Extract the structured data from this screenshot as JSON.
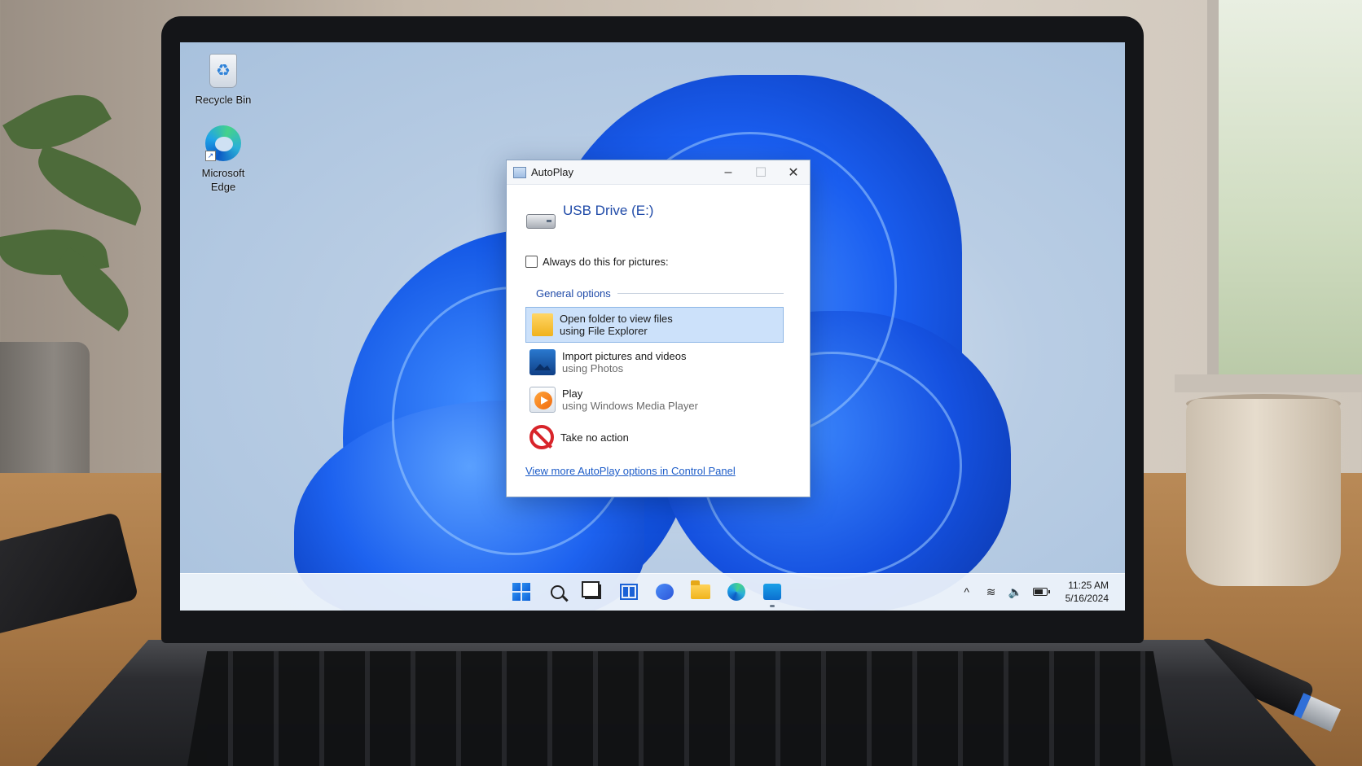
{
  "desktop": {
    "icons": [
      {
        "label": "Recycle Bin"
      },
      {
        "label": "Microsoft\nEdge",
        "label_line1": "Microsoft",
        "label_line2": "Edge"
      }
    ]
  },
  "dialog": {
    "title": "AutoPlay",
    "device_name": "USB Drive (E:)",
    "always_label": "Always do this for pictures:",
    "always_checked": false,
    "group_title": "General options",
    "options": [
      {
        "title": "Open folder to view files",
        "subtitle": "using File Explorer",
        "icon": "folder-icon",
        "selected": true
      },
      {
        "title": "Import pictures and videos",
        "subtitle": "using Photos",
        "icon": "photos-icon",
        "selected": false
      },
      {
        "title": "Play",
        "subtitle": "using Windows Media Player",
        "icon": "media-player-icon",
        "selected": false
      },
      {
        "title": "Take no action",
        "subtitle": "",
        "icon": "no-action-icon",
        "selected": false
      }
    ],
    "control_panel_link": "View more AutoPlay options in Control Panel",
    "controls": {
      "minimize": "–",
      "maximize": "☐",
      "close": "✕"
    }
  },
  "taskbar": {
    "apps": [
      "start-icon",
      "search-icon",
      "task-view-icon",
      "widgets-icon",
      "chat-icon",
      "file-explorer-icon",
      "edge-icon",
      "store-icon"
    ],
    "tray": {
      "overflow": "^",
      "wifi": "wifi-icon",
      "volume": "volume-icon",
      "battery": "battery-icon"
    },
    "time": "11:25 AM",
    "date": "5/16/2024"
  },
  "colors": {
    "accent": "#1f4aa8",
    "link": "#1d5cc8",
    "selection": "#cce1fa",
    "wallpaper_blue": "#1458e6"
  }
}
